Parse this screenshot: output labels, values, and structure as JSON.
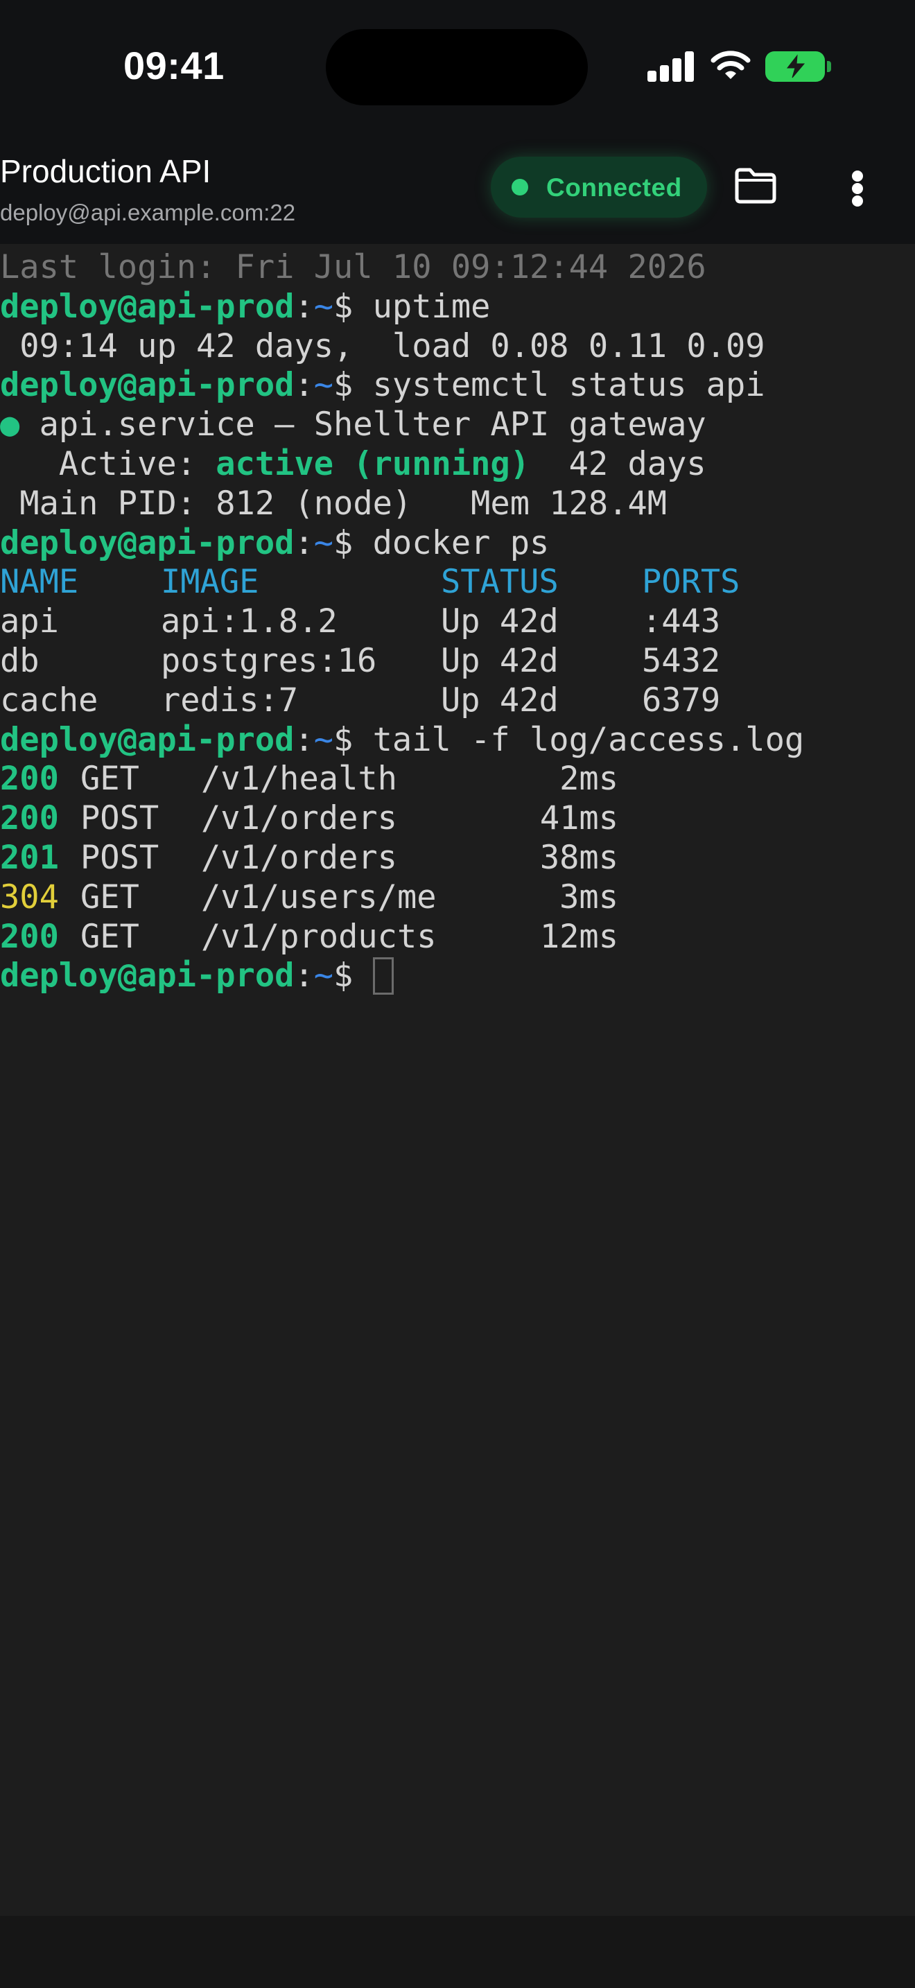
{
  "status_bar": {
    "time": "09:41"
  },
  "header": {
    "title": "Production API",
    "subtitle": "deploy@api.example.com:22",
    "status": "Connected",
    "status_color": "#33d17a"
  },
  "terminal": {
    "last_login": "Last login: Fri Jul 10 09:12:44 2026",
    "prompt_user": "deploy@api-prod",
    "prompt_path": "~",
    "commands": {
      "uptime": "uptime",
      "systemctl": "systemctl status api",
      "docker": "docker ps",
      "tail": "tail -f log/access.log"
    },
    "uptime_output": " 09:14 up 42 days,  load 0.08 0.11 0.09",
    "service": {
      "bullet": "●",
      "line": " api.service – Shellter API gateway",
      "active_label": "   Active: ",
      "active_value": "active (running)",
      "active_tail": "  42 days",
      "pid_line": " Main PID: 812 (node)   Mem 128.4M"
    },
    "docker": {
      "headers": [
        "NAME",
        "IMAGE",
        "STATUS",
        "PORTS"
      ],
      "rows": [
        [
          "api",
          "api:1.8.2",
          "Up 42d",
          ":443"
        ],
        [
          "db",
          "postgres:16",
          "Up 42d",
          "5432"
        ],
        [
          "cache",
          "redis:7",
          "Up 42d",
          "6379"
        ]
      ]
    },
    "log": [
      {
        "code": "200",
        "method": "GET",
        "path": "/v1/health",
        "time": "2ms"
      },
      {
        "code": "200",
        "method": "POST",
        "path": "/v1/orders",
        "time": "41ms"
      },
      {
        "code": "201",
        "method": "POST",
        "path": "/v1/orders",
        "time": "38ms"
      },
      {
        "code": "304",
        "method": "GET",
        "path": "/v1/users/me",
        "time": "3ms"
      },
      {
        "code": "200",
        "method": "GET",
        "path": "/v1/products",
        "time": "12ms"
      }
    ]
  }
}
